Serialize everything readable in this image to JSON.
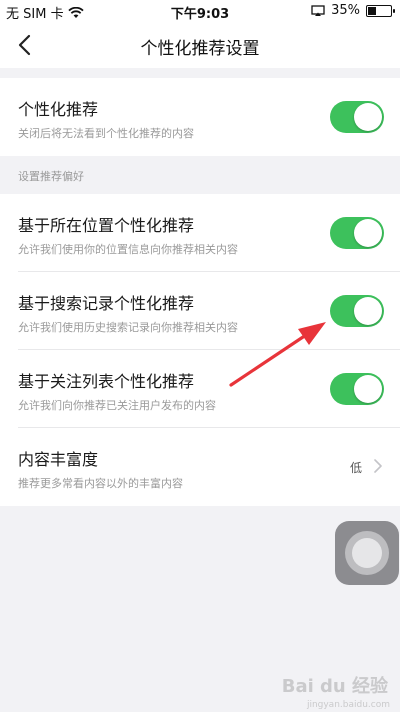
{
  "status_bar": {
    "carrier": "无 SIM 卡",
    "time": "下午9:03",
    "battery_percent": "35%",
    "battery_level": 0.35
  },
  "nav": {
    "title": "个性化推荐设置"
  },
  "main_setting": {
    "title": "个性化推荐",
    "description": "关闭后将无法看到个性化推荐的内容",
    "enabled": true
  },
  "preferences": {
    "section_label": "设置推荐偏好",
    "items": [
      {
        "title": "基于所在位置个性化推荐",
        "description": "允许我们使用你的位置信息向你推荐相关内容",
        "enabled": true
      },
      {
        "title": "基于搜索记录个性化推荐",
        "description": "允许我们使用历史搜索记录向你推荐相关内容",
        "enabled": true
      },
      {
        "title": "基于关注列表个性化推荐",
        "description": "允许我们向你推荐已关注用户发布的内容",
        "enabled": true
      }
    ]
  },
  "richness": {
    "title": "内容丰富度",
    "description": "推荐更多常看内容以外的丰富内容",
    "value": "低"
  },
  "watermark": {
    "text": "Bai du 经验",
    "sub": "jingyan.baidu.com"
  },
  "colors": {
    "toggle_on": "#3dc15c",
    "annotation_arrow": "#e8343a"
  }
}
